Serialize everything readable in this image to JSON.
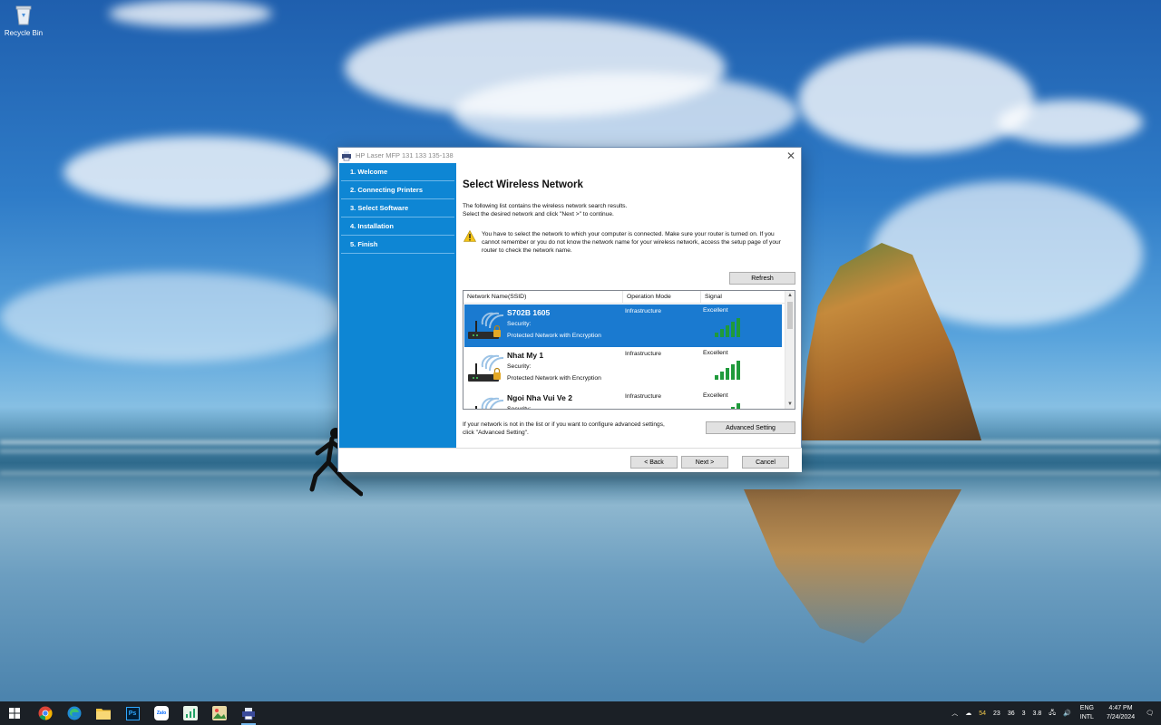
{
  "desktop": {
    "icons": [
      {
        "label": "Recycle Bin",
        "icon": "recycle-bin-icon"
      }
    ]
  },
  "window": {
    "title": "HP Laser MFP 131 133 135-138",
    "close_glyph": "✕"
  },
  "sidebar": {
    "steps": [
      {
        "label": "1. Welcome"
      },
      {
        "label": "2. Connecting Printers"
      },
      {
        "label": "3. Select Software"
      },
      {
        "label": "4. Installation"
      },
      {
        "label": "5. Finish"
      }
    ]
  },
  "main": {
    "heading": "Select Wireless Network",
    "description_line1": "The following list contains the wireless network search results.",
    "description_line2": "Select the desired network and click \"Next >\" to continue.",
    "warning": "You have to select the network to which your computer is connected. Make sure your router is turned on. If you cannot remember or you do not know the network name for your wireless network,  access the setup page of your router to check the network name.",
    "refresh_label": "Refresh",
    "columns": {
      "ssid": "Network Name(SSID)",
      "mode": "Operation Mode",
      "signal": "Signal"
    },
    "networks": [
      {
        "ssid": "S702B 1605",
        "security_label": "Security:",
        "security": "Protected Network with Encryption",
        "mode": "Infrastructure",
        "signal": "Excellent",
        "selected": true
      },
      {
        "ssid": "Nhat My 1",
        "security_label": "Security:",
        "security": "Protected Network with Encryption",
        "mode": "Infrastructure",
        "signal": "Excellent",
        "selected": false
      },
      {
        "ssid": "Ngoi Nha Vui Ve 2",
        "security_label": "Security:",
        "security": "Protected Network with Encryption",
        "mode": "Infrastructure",
        "signal": "Excellent",
        "selected": false
      }
    ],
    "footer_note_line1": "If your network is not in the list or if you want to configure advanced settings,",
    "footer_note_line2": "click \"Advanced Setting\".",
    "advanced_label": "Advanced Setting"
  },
  "buttons": {
    "back": "< Back",
    "next": "Next >",
    "cancel": "Cancel"
  },
  "colors": {
    "sidebar": "#0e86d4",
    "selection": "#1a7ad0",
    "signal_bars": "#1f9a3b",
    "taskbar": "#1b2026"
  },
  "taskbar": {
    "apps": [
      "windows-start-icon",
      "chrome-icon",
      "edge-icon",
      "file-explorer-icon",
      "photoshop-icon",
      "zalo-icon",
      "chart-app-icon",
      "image-app-icon",
      "hp-installer-icon"
    ],
    "photoshop_label": "Ps",
    "zalo_label": "Zalo",
    "tray": {
      "weather_temp": "54",
      "stats": [
        "23",
        "36",
        "3",
        "3.8"
      ],
      "lang_line1": "ENG",
      "lang_line2": "INTL",
      "time": "4:47 PM",
      "date": "7/24/2024"
    }
  }
}
